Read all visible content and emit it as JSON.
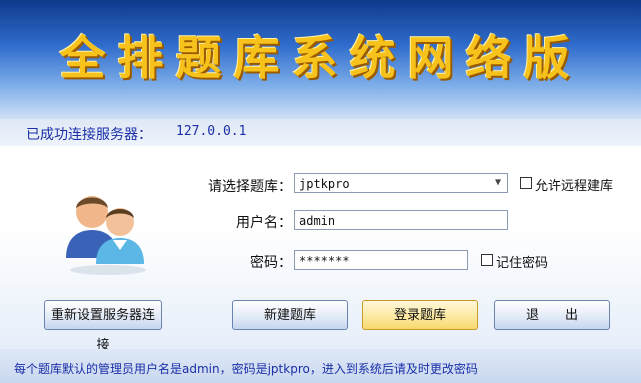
{
  "banner": {
    "title": "全排题库系统网络版"
  },
  "status": {
    "label": "已成功连接服务器：",
    "ip": "127.0.0.1"
  },
  "form": {
    "db_label": "请选择题库：",
    "db_value": "jptkpro",
    "username_label": "用户名：",
    "username_value": "admin",
    "password_label": "密码：",
    "password_value": "*******",
    "remote_db_label": "允许远程建库",
    "remember_label": "记住密码"
  },
  "buttons": {
    "reset_server": "重新设置服务器连接",
    "new_db": "新建题库",
    "login": "登录题库",
    "exit": "退　　出"
  },
  "footer": {
    "notice": "每个题库默认的管理员用户名是admin，密码是jptkpro，进入到系统后请及时更改密码"
  }
}
